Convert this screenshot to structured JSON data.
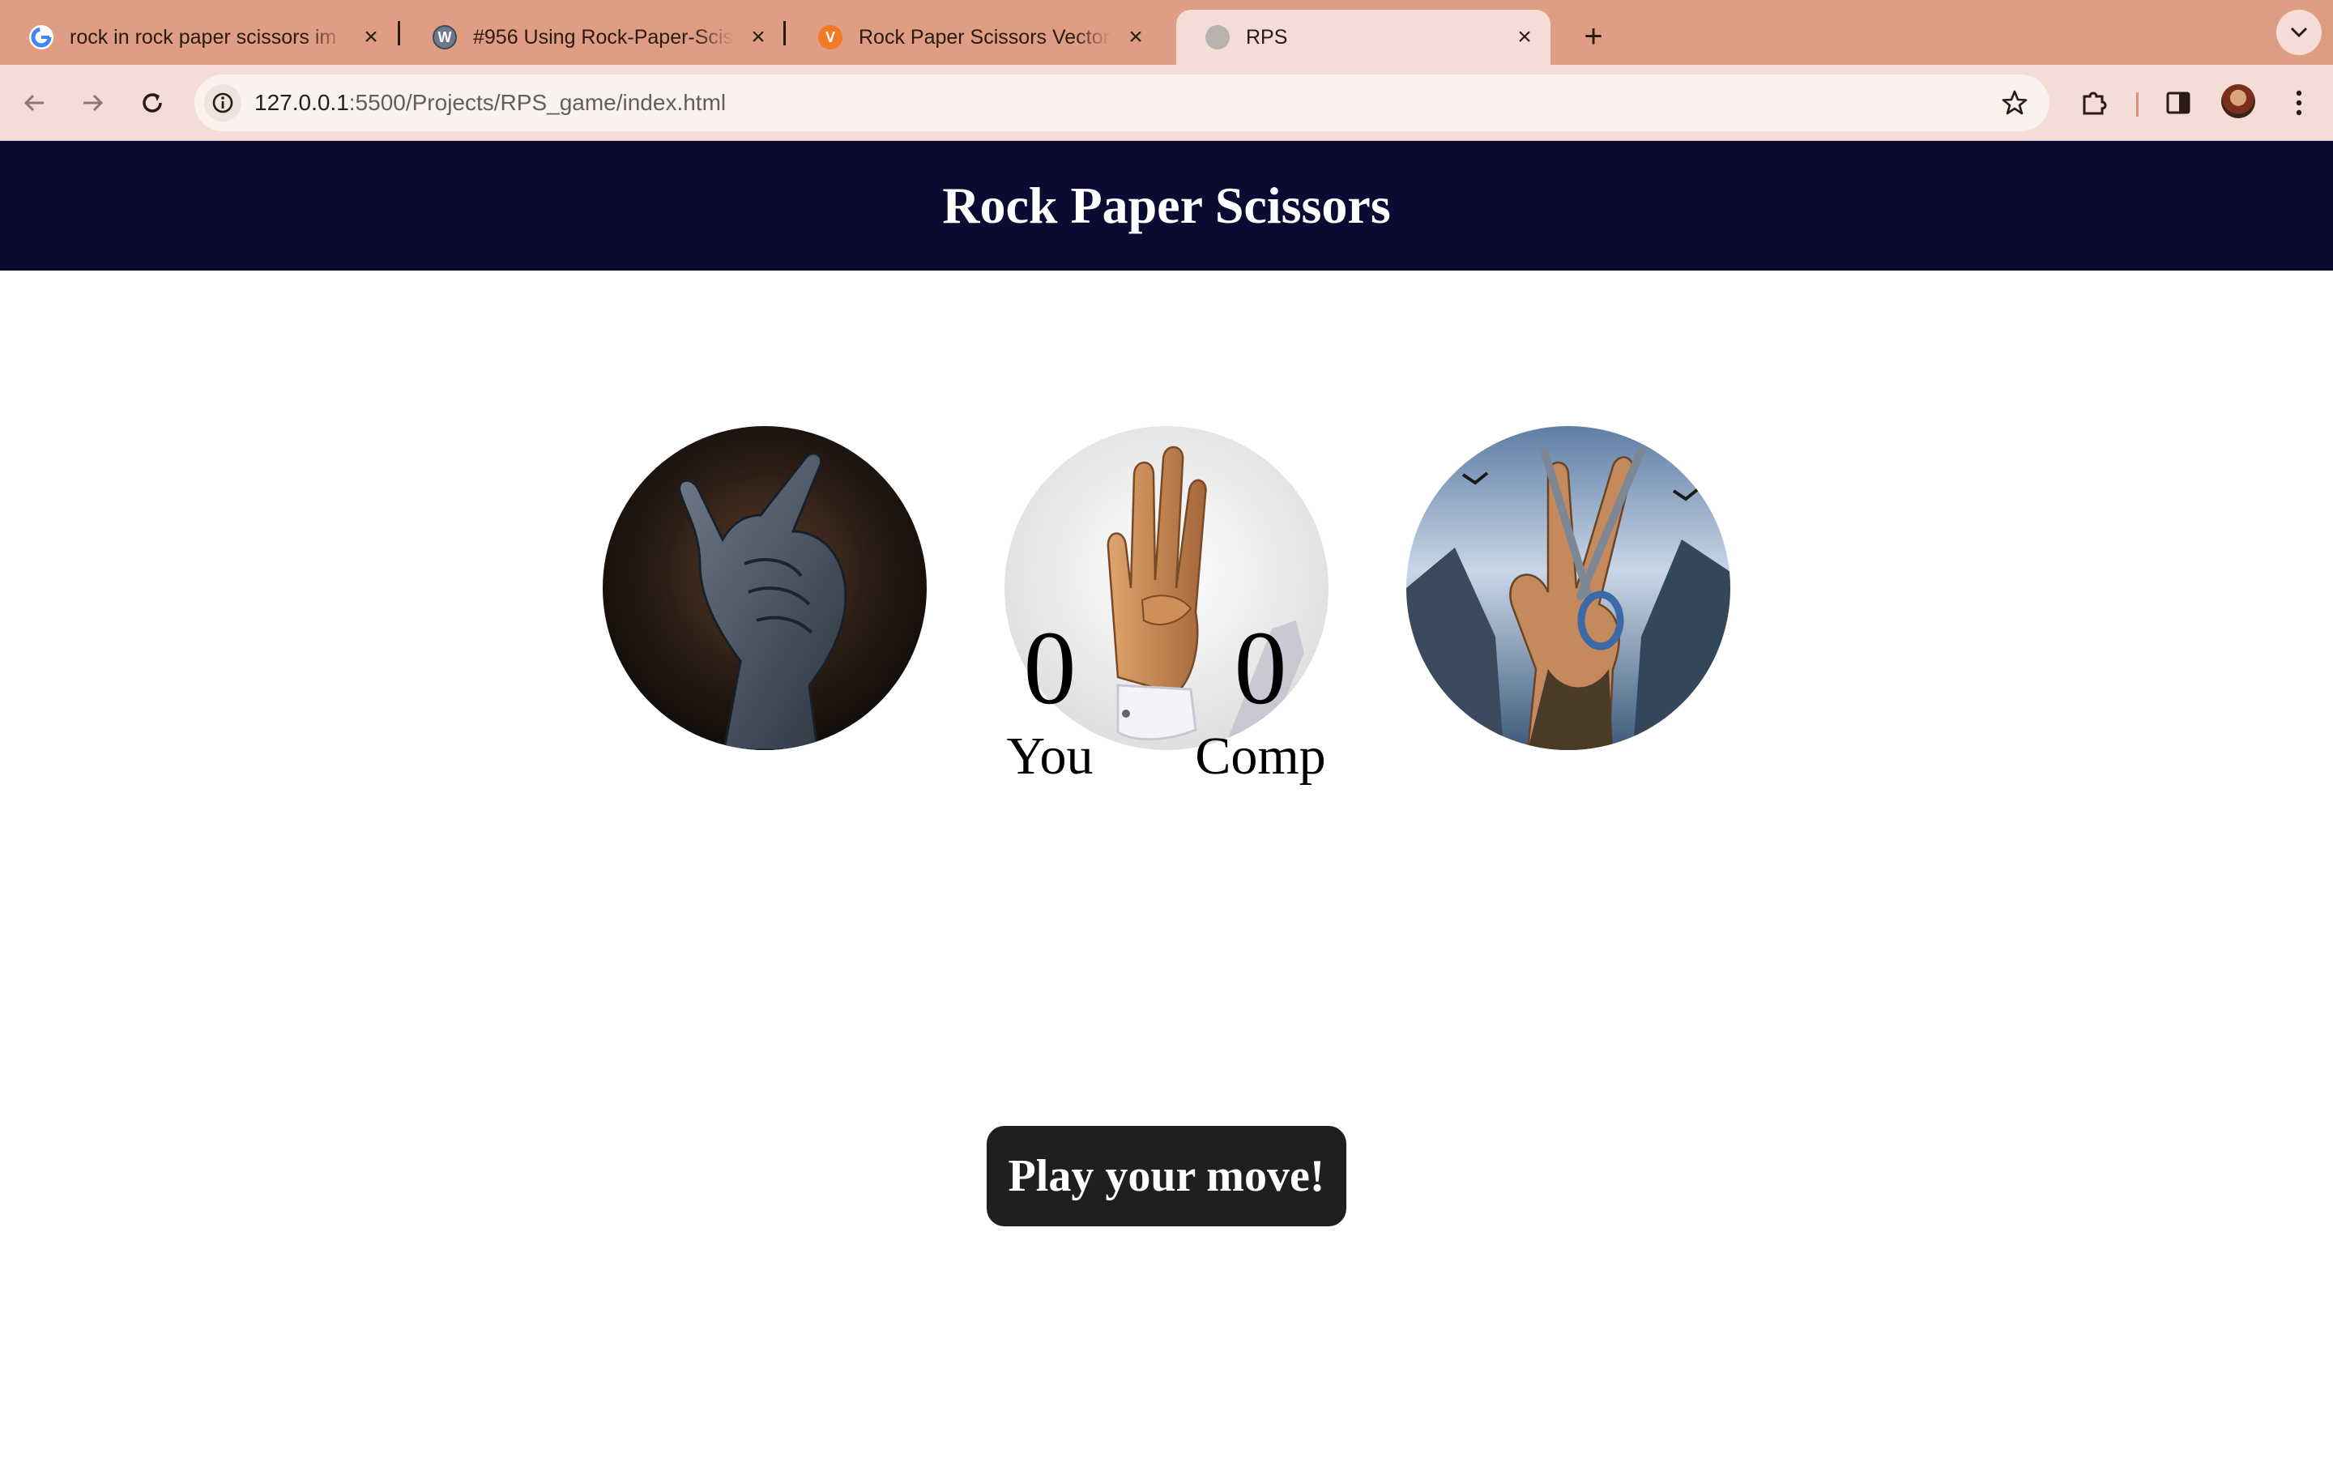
{
  "browser": {
    "tabs": [
      {
        "label": "rock in rock paper scissors im",
        "favicon": "google-g-icon"
      },
      {
        "label": "#956 Using Rock-Paper-Scis",
        "favicon": "wordpress-icon"
      },
      {
        "label": "Rock Paper Scissors Vector A",
        "favicon": "vecteezy-icon"
      },
      {
        "label": "RPS",
        "favicon": "globe-icon"
      }
    ],
    "url_host": "127.0.0.1",
    "url_path": ":5500/Projects/RPS_game/index.html"
  },
  "header": {
    "title": "Rock Paper Scissors"
  },
  "choices": [
    {
      "id": "rock",
      "icon": "rock-hand-image"
    },
    {
      "id": "paper",
      "icon": "paper-hand-image"
    },
    {
      "id": "scissors",
      "icon": "scissors-hand-image"
    }
  ],
  "scoreboard": {
    "user": {
      "score": "0",
      "label": "You"
    },
    "comp": {
      "score": "0",
      "label": "Comp"
    }
  },
  "message": "Play your move!",
  "colors": {
    "tabstrip": "#df9d84",
    "toolbar": "#f3ddd6",
    "header_bg": "#0a0a33",
    "button_bg": "#1f1f1f"
  }
}
